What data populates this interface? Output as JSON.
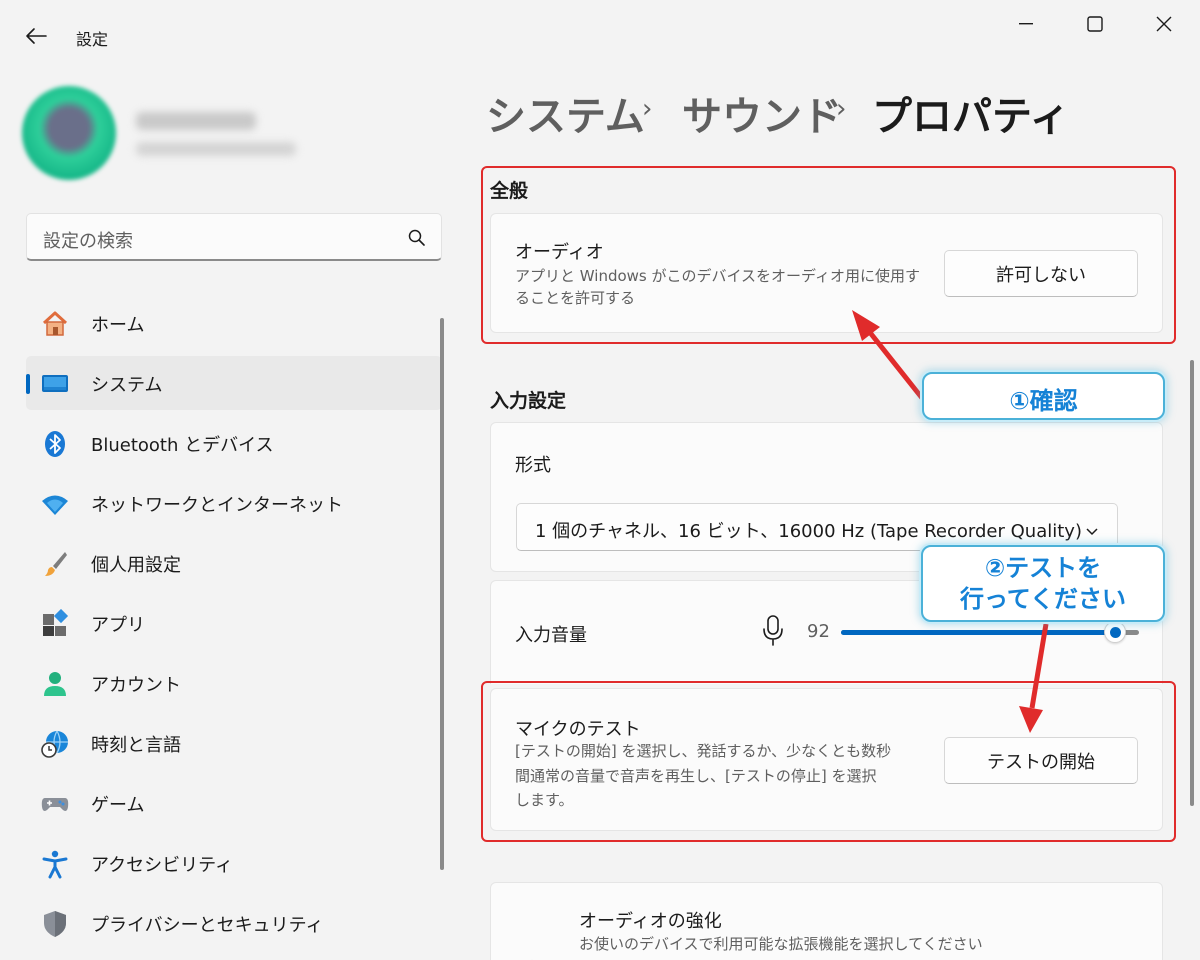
{
  "window": {
    "app_title": "設定",
    "icons": {
      "back": "back-arrow-icon",
      "minimize": "minimize-icon",
      "maximize": "maximize-icon",
      "close": "close-icon"
    }
  },
  "search": {
    "placeholder": "設定の検索"
  },
  "nav": {
    "items": [
      {
        "label": "ホーム",
        "icon": "home-icon"
      },
      {
        "label": "システム",
        "icon": "system-icon",
        "active": true
      },
      {
        "label": "Bluetooth とデバイス",
        "icon": "bluetooth-icon"
      },
      {
        "label": "ネットワークとインターネット",
        "icon": "wifi-icon"
      },
      {
        "label": "個人用設定",
        "icon": "brush-icon"
      },
      {
        "label": "アプリ",
        "icon": "apps-icon"
      },
      {
        "label": "アカウント",
        "icon": "account-icon"
      },
      {
        "label": "時刻と言語",
        "icon": "globe-clock-icon"
      },
      {
        "label": "ゲーム",
        "icon": "gamepad-icon"
      },
      {
        "label": "アクセシビリティ",
        "icon": "accessibility-icon"
      },
      {
        "label": "プライバシーとセキュリティ",
        "icon": "shield-icon"
      }
    ]
  },
  "breadcrumb": {
    "items": [
      "システム",
      "サウンド",
      "プロパティ"
    ],
    "separator": "›"
  },
  "general": {
    "title": "全般",
    "audio": {
      "title": "オーディオ",
      "desc_line1": "アプリと Windows がこのデバイスをオーディオ用に使用す",
      "desc_line2": "ることを許可する",
      "button": "許可しない"
    }
  },
  "input": {
    "title": "入力設定",
    "format": {
      "label": "形式",
      "value": "1 個のチャネル、16 ビット、16000 Hz (Tape Recorder Quality)"
    },
    "volume": {
      "label": "入力音量",
      "value": "92",
      "level_percent": 92
    },
    "mic_test": {
      "title": "マイクのテスト",
      "desc_line1": "[テストの開始] を選択し、発話するか、少なくとも数秒",
      "desc_line2": "間通常の音量で音声を再生し、[テストの停止] を選択",
      "desc_line3": "します。",
      "button": "テストの開始"
    }
  },
  "enhance": {
    "title": "オーディオの強化",
    "desc": "お使いのデバイスで利用可能な拡張機能を選択してください"
  },
  "annotations": {
    "callout1": "①確認",
    "callout2_line1": "②テストを",
    "callout2_line2": "行ってください",
    "colors": {
      "box": "#e02b2b",
      "callout_text": "#1582d6",
      "callout_border": "#4bb1d8"
    }
  },
  "colors": {
    "accent": "#0067c0",
    "background": "#f3f3f3",
    "card": "#fbfbfb"
  }
}
